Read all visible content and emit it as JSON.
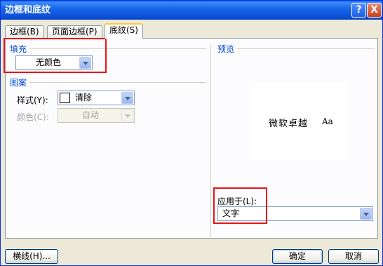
{
  "window": {
    "title": "边框和底纹"
  },
  "titlebar_buttons": {
    "help": "?",
    "close": "X"
  },
  "tabs": [
    {
      "label": "边框(B)",
      "active": false
    },
    {
      "label": "页面边框(P)",
      "active": false
    },
    {
      "label": "底纹(S)",
      "active": true
    }
  ],
  "fill": {
    "group_label": "填充",
    "value": "无颜色"
  },
  "pattern": {
    "group_label": "图案",
    "style_label": "样式(Y):",
    "style_value": "清除",
    "color_label": "颜色(C):",
    "color_value": "自动"
  },
  "preview": {
    "group_label": "预览",
    "sample_text": "微软卓越",
    "sample_latin": "Aa"
  },
  "apply_to": {
    "label": "应用于(L):",
    "value": "文字"
  },
  "buttons": {
    "horizontal_line": "横线(H)...",
    "ok": "确定",
    "cancel": "取消"
  },
  "colors": {
    "titlebar": "#0a4fd8",
    "group_label": "#0046d5",
    "highlight_box": "#e8141a",
    "dialog_bg": "#ece9d8"
  }
}
